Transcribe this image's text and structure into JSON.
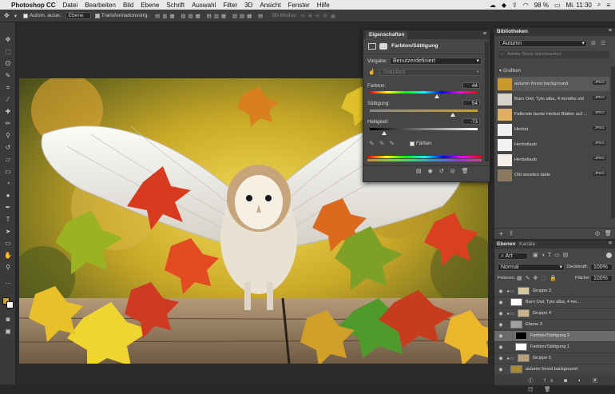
{
  "menubar": {
    "app": "Photoshop CC",
    "items": [
      "Datei",
      "Bearbeiten",
      "Bild",
      "Ebene",
      "Schrift",
      "Auswahl",
      "Filter",
      "3D",
      "Ansicht",
      "Fenster",
      "Hilfe"
    ],
    "battery": "98 %",
    "time": "Mi. 11:30"
  },
  "options": {
    "auto_select_label": "Autom. ausw.:",
    "auto_select_value": "Ebene",
    "transform_label": "Transformationsstrg.",
    "mode_3d": "3D-Modus:"
  },
  "properties": {
    "tab": "Eigenschaften",
    "title": "Farbton/Sättigung",
    "preset_label": "Vorgabe:",
    "preset_value": "Benutzerdefiniert",
    "channel_value": "Standard",
    "hue_label": "Farbton:",
    "hue_value": "44",
    "sat_label": "Sättigung:",
    "sat_value": "54",
    "light_label": "Helligkeit:",
    "light_value": "-73",
    "colorize_label": "Färben"
  },
  "libraries": {
    "tab": "Bibliotheken",
    "library": "Autumn",
    "search_placeholder": "Adobe Stock durchsuchen",
    "section": "Grafiken",
    "badge": "JPEG",
    "items": [
      {
        "label": "autumn forest background",
        "color": "#c79a2a"
      },
      {
        "label": "Barn Owl, Tyto alba, 4 months old",
        "color": "#d8d3c8"
      },
      {
        "label": "Fallende bunte Herbst Blätter auf ...",
        "color": "#e0b060"
      },
      {
        "label": "Herbst",
        "color": "#f0f0f0"
      },
      {
        "label": "Herbstlaub",
        "color": "#f2f2f2"
      },
      {
        "label": "Herbstlaub",
        "color": "#f2efe8"
      },
      {
        "label": "Old wooden table",
        "color": "#8a7a60"
      }
    ]
  },
  "layers": {
    "tab1": "Ebenen",
    "tab2": "Kanäle",
    "filter_value": "Art",
    "blend_mode": "Normal",
    "opacity_label": "Deckkraft:",
    "opacity_value": "100%",
    "lock_label": "Fixieren:",
    "fill_label": "Fläche:",
    "fill_value": "100%",
    "rows": [
      {
        "name": "Gruppe 3",
        "thumb": "#d9c7a0",
        "selected": false
      },
      {
        "name": "Barn Owl, Tyto alba, 4 mo...",
        "thumb": "#ffffff",
        "selected": false
      },
      {
        "name": "Gruppe 4",
        "thumb": "#c9b58a",
        "selected": false
      },
      {
        "name": "Ebene 3",
        "thumb": "#a0a0a0",
        "selected": false
      },
      {
        "name": "Farbton/Sättigung 2",
        "thumb": "#000000",
        "selected": true
      },
      {
        "name": "Farbton/Sättigung 1",
        "thumb": "#ffffff",
        "selected": false
      },
      {
        "name": "Gruppe 5",
        "thumb": "#b5a27c",
        "selected": false
      },
      {
        "name": "autumn forest background",
        "thumb": "#a88a30",
        "selected": false
      }
    ]
  },
  "colors": {
    "foreground": "#c9a227",
    "background": "#ffffff"
  }
}
